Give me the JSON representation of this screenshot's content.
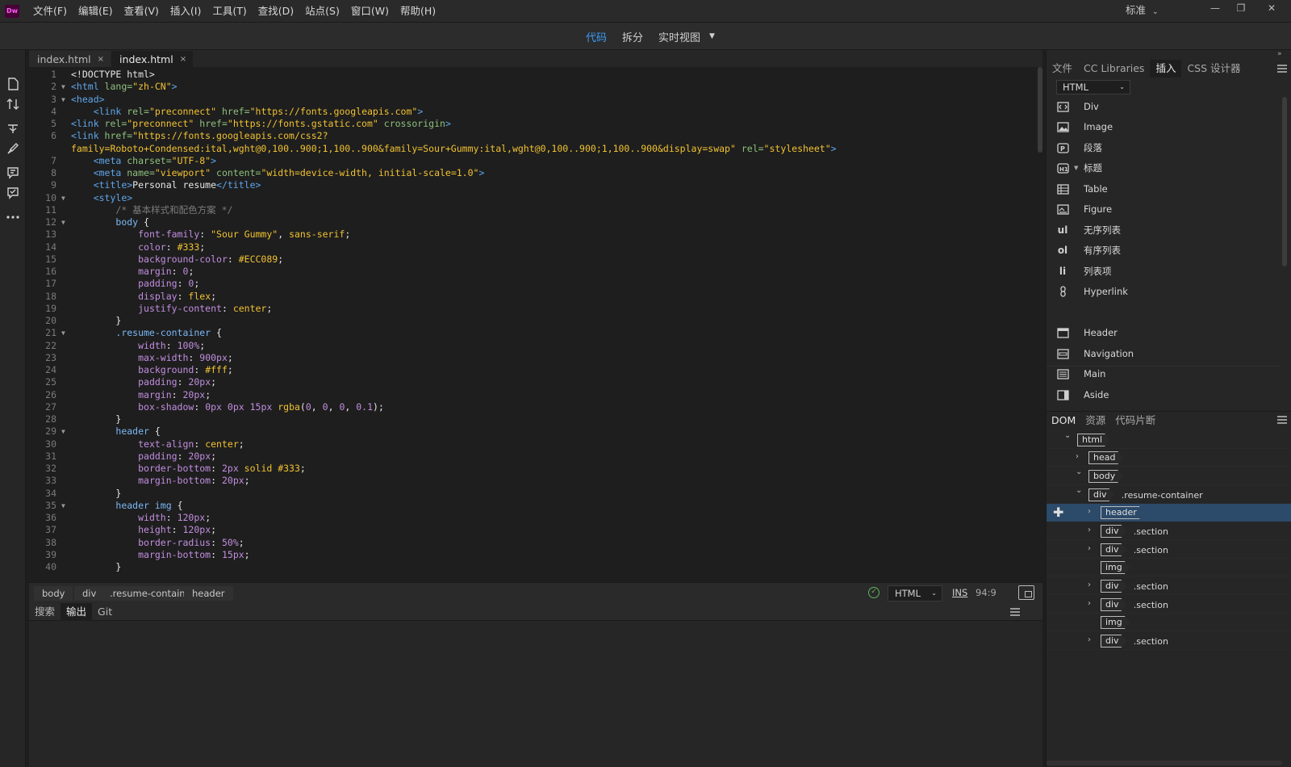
{
  "app": {
    "logo": "Dw",
    "menu": [
      "文件(F)",
      "编辑(E)",
      "查看(V)",
      "插入(I)",
      "工具(T)",
      "查找(D)",
      "站点(S)",
      "窗口(W)",
      "帮助(H)"
    ],
    "workspace": "标准",
    "window_controls": [
      "minimize",
      "restore",
      "close"
    ]
  },
  "viewbar": {
    "modes": [
      "代码",
      "拆分",
      "实时视图"
    ],
    "active": "代码"
  },
  "left_tools": [
    "file-icon",
    "transfer-icon",
    "split-arrows-icon",
    "brush-icon",
    "comment-icon",
    "checklist-icon",
    "more-icon"
  ],
  "doc_tabs": [
    {
      "label": "index.html",
      "active": false
    },
    {
      "label": "index.html",
      "active": true
    }
  ],
  "code_lines": [
    {
      "n": "1",
      "fold": "",
      "tokens": [
        [
          "t-txt",
          "<!DOCTYPE html>"
        ]
      ]
    },
    {
      "n": "2",
      "fold": "▼",
      "tokens": [
        [
          "t-tag",
          "<html "
        ],
        [
          "t-attr",
          "lang="
        ],
        [
          "t-str",
          "\"zh-CN\""
        ],
        [
          "t-tag",
          ">"
        ]
      ]
    },
    {
      "n": "3",
      "fold": "▼",
      "tokens": [
        [
          "t-tag",
          "<head>"
        ]
      ]
    },
    {
      "n": "4",
      "fold": "",
      "tokens": [
        [
          "t-txt",
          "    "
        ],
        [
          "t-tag",
          "<link "
        ],
        [
          "t-attr",
          "rel="
        ],
        [
          "t-str",
          "\"preconnect\" "
        ],
        [
          "t-attr",
          "href="
        ],
        [
          "t-str",
          "\"https://fonts.googleapis.com\""
        ],
        [
          "t-tag",
          ">"
        ]
      ]
    },
    {
      "n": "5",
      "fold": "",
      "tokens": [
        [
          "t-tag",
          "<link "
        ],
        [
          "t-attr",
          "rel="
        ],
        [
          "t-str",
          "\"preconnect\" "
        ],
        [
          "t-attr",
          "href="
        ],
        [
          "t-str",
          "\"https://fonts.gstatic.com\" "
        ],
        [
          "t-attr",
          "crossorigin"
        ],
        [
          "t-tag",
          ">"
        ]
      ]
    },
    {
      "n": "6",
      "fold": "",
      "tokens": [
        [
          "t-tag",
          "<link "
        ],
        [
          "t-attr",
          "href="
        ],
        [
          "t-str",
          "\"https://fonts.googleapis.com/css2?"
        ]
      ]
    },
    {
      "n": "",
      "fold": "",
      "tokens": [
        [
          "t-str",
          "family=Roboto+Condensed:ital,wght@0,100..900;1,100..900&family=Sour+Gummy:ital,wght@0,100..900;1,100..900&display=swap\" "
        ],
        [
          "t-attr",
          "rel="
        ],
        [
          "t-str",
          "\"stylesheet\""
        ],
        [
          "t-tag",
          ">"
        ]
      ]
    },
    {
      "n": "7",
      "fold": "",
      "tokens": [
        [
          "t-txt",
          "    "
        ],
        [
          "t-tag",
          "<meta "
        ],
        [
          "t-attr",
          "charset="
        ],
        [
          "t-str",
          "\"UTF-8\""
        ],
        [
          "t-tag",
          ">"
        ]
      ]
    },
    {
      "n": "8",
      "fold": "",
      "tokens": [
        [
          "t-txt",
          "    "
        ],
        [
          "t-tag",
          "<meta "
        ],
        [
          "t-attr",
          "name="
        ],
        [
          "t-str",
          "\"viewport\" "
        ],
        [
          "t-attr",
          "content="
        ],
        [
          "t-str",
          "\"width=device-width, initial-scale=1.0\""
        ],
        [
          "t-tag",
          ">"
        ]
      ]
    },
    {
      "n": "9",
      "fold": "",
      "tokens": [
        [
          "t-txt",
          "    "
        ],
        [
          "t-tag",
          "<title>"
        ],
        [
          "t-txt",
          "Personal resume"
        ],
        [
          "t-tag",
          "</title>"
        ]
      ]
    },
    {
      "n": "10",
      "fold": "▼",
      "tokens": [
        [
          "t-txt",
          "    "
        ],
        [
          "t-tag",
          "<style>"
        ]
      ]
    },
    {
      "n": "11",
      "fold": "",
      "tokens": [
        [
          "t-txt",
          "        "
        ],
        [
          "t-com",
          "/* 基本样式和配色方案 */"
        ]
      ]
    },
    {
      "n": "12",
      "fold": "▼",
      "tokens": [
        [
          "t-txt",
          "        "
        ],
        [
          "t-sel",
          "body "
        ],
        [
          "t-txt",
          "{"
        ]
      ]
    },
    {
      "n": "13",
      "fold": "",
      "tokens": [
        [
          "t-txt",
          "            "
        ],
        [
          "t-prop",
          "font-family"
        ],
        [
          "t-txt",
          ": "
        ],
        [
          "t-val",
          "\"Sour Gummy\""
        ],
        [
          "t-txt",
          ", "
        ],
        [
          "t-val",
          "sans-serif"
        ],
        [
          "t-txt",
          ";"
        ]
      ]
    },
    {
      "n": "14",
      "fold": "",
      "tokens": [
        [
          "t-txt",
          "            "
        ],
        [
          "t-prop",
          "color"
        ],
        [
          "t-txt",
          ": "
        ],
        [
          "t-val",
          "#333"
        ],
        [
          "t-txt",
          ";"
        ]
      ]
    },
    {
      "n": "15",
      "fold": "",
      "tokens": [
        [
          "t-txt",
          "            "
        ],
        [
          "t-prop",
          "background-color"
        ],
        [
          "t-txt",
          ": "
        ],
        [
          "t-val",
          "#ECC089"
        ],
        [
          "t-txt",
          ";"
        ]
      ]
    },
    {
      "n": "16",
      "fold": "",
      "tokens": [
        [
          "t-txt",
          "            "
        ],
        [
          "t-prop",
          "margin"
        ],
        [
          "t-txt",
          ": "
        ],
        [
          "t-num",
          "0"
        ],
        [
          "t-txt",
          ";"
        ]
      ]
    },
    {
      "n": "17",
      "fold": "",
      "tokens": [
        [
          "t-txt",
          "            "
        ],
        [
          "t-prop",
          "padding"
        ],
        [
          "t-txt",
          ": "
        ],
        [
          "t-num",
          "0"
        ],
        [
          "t-txt",
          ";"
        ]
      ]
    },
    {
      "n": "18",
      "fold": "",
      "tokens": [
        [
          "t-txt",
          "            "
        ],
        [
          "t-prop",
          "display"
        ],
        [
          "t-txt",
          ": "
        ],
        [
          "t-val",
          "flex"
        ],
        [
          "t-txt",
          ";"
        ]
      ]
    },
    {
      "n": "19",
      "fold": "",
      "tokens": [
        [
          "t-txt",
          "            "
        ],
        [
          "t-prop",
          "justify-content"
        ],
        [
          "t-txt",
          ": "
        ],
        [
          "t-val",
          "center"
        ],
        [
          "t-txt",
          ";"
        ]
      ]
    },
    {
      "n": "20",
      "fold": "",
      "tokens": [
        [
          "t-txt",
          "        }"
        ]
      ]
    },
    {
      "n": "21",
      "fold": "▼",
      "tokens": [
        [
          "t-txt",
          "        "
        ],
        [
          "t-sel",
          ".resume-container "
        ],
        [
          "t-txt",
          "{"
        ]
      ]
    },
    {
      "n": "22",
      "fold": "",
      "tokens": [
        [
          "t-txt",
          "            "
        ],
        [
          "t-prop",
          "width"
        ],
        [
          "t-txt",
          ": "
        ],
        [
          "t-num",
          "100%"
        ],
        [
          "t-txt",
          ";"
        ]
      ]
    },
    {
      "n": "23",
      "fold": "",
      "tokens": [
        [
          "t-txt",
          "            "
        ],
        [
          "t-prop",
          "max-width"
        ],
        [
          "t-txt",
          ": "
        ],
        [
          "t-num",
          "900px"
        ],
        [
          "t-txt",
          ";"
        ]
      ]
    },
    {
      "n": "24",
      "fold": "",
      "tokens": [
        [
          "t-txt",
          "            "
        ],
        [
          "t-prop",
          "background"
        ],
        [
          "t-txt",
          ": "
        ],
        [
          "t-val",
          "#fff"
        ],
        [
          "t-txt",
          ";"
        ]
      ]
    },
    {
      "n": "25",
      "fold": "",
      "tokens": [
        [
          "t-txt",
          "            "
        ],
        [
          "t-prop",
          "padding"
        ],
        [
          "t-txt",
          ": "
        ],
        [
          "t-num",
          "20px"
        ],
        [
          "t-txt",
          ";"
        ]
      ]
    },
    {
      "n": "26",
      "fold": "",
      "tokens": [
        [
          "t-txt",
          "            "
        ],
        [
          "t-prop",
          "margin"
        ],
        [
          "t-txt",
          ": "
        ],
        [
          "t-num",
          "20px"
        ],
        [
          "t-txt",
          ";"
        ]
      ]
    },
    {
      "n": "27",
      "fold": "",
      "tokens": [
        [
          "t-txt",
          "            "
        ],
        [
          "t-prop",
          "box-shadow"
        ],
        [
          "t-txt",
          ": "
        ],
        [
          "t-num",
          "0px 0px 15px "
        ],
        [
          "t-val",
          "rgba"
        ],
        [
          "t-txt",
          "("
        ],
        [
          "t-num",
          "0"
        ],
        [
          "t-txt",
          ", "
        ],
        [
          "t-num",
          "0"
        ],
        [
          "t-txt",
          ", "
        ],
        [
          "t-num",
          "0"
        ],
        [
          "t-txt",
          ", "
        ],
        [
          "t-num",
          "0.1"
        ],
        [
          "t-txt",
          ");"
        ]
      ]
    },
    {
      "n": "28",
      "fold": "",
      "tokens": [
        [
          "t-txt",
          "        }"
        ]
      ]
    },
    {
      "n": "29",
      "fold": "▼",
      "tokens": [
        [
          "t-txt",
          "        "
        ],
        [
          "t-sel",
          "header "
        ],
        [
          "t-txt",
          "{"
        ]
      ]
    },
    {
      "n": "30",
      "fold": "",
      "tokens": [
        [
          "t-txt",
          "            "
        ],
        [
          "t-prop",
          "text-align"
        ],
        [
          "t-txt",
          ": "
        ],
        [
          "t-val",
          "center"
        ],
        [
          "t-txt",
          ";"
        ]
      ]
    },
    {
      "n": "31",
      "fold": "",
      "tokens": [
        [
          "t-txt",
          "            "
        ],
        [
          "t-prop",
          "padding"
        ],
        [
          "t-txt",
          ": "
        ],
        [
          "t-num",
          "20px"
        ],
        [
          "t-txt",
          ";"
        ]
      ]
    },
    {
      "n": "32",
      "fold": "",
      "tokens": [
        [
          "t-txt",
          "            "
        ],
        [
          "t-prop",
          "border-bottom"
        ],
        [
          "t-txt",
          ": "
        ],
        [
          "t-num",
          "2px "
        ],
        [
          "t-val",
          "solid #333"
        ],
        [
          "t-txt",
          ";"
        ]
      ]
    },
    {
      "n": "33",
      "fold": "",
      "tokens": [
        [
          "t-txt",
          "            "
        ],
        [
          "t-prop",
          "margin-bottom"
        ],
        [
          "t-txt",
          ": "
        ],
        [
          "t-num",
          "20px"
        ],
        [
          "t-txt",
          ";"
        ]
      ]
    },
    {
      "n": "34",
      "fold": "",
      "tokens": [
        [
          "t-txt",
          "        }"
        ]
      ]
    },
    {
      "n": "35",
      "fold": "▼",
      "tokens": [
        [
          "t-txt",
          "        "
        ],
        [
          "t-sel",
          "header img "
        ],
        [
          "t-txt",
          "{"
        ]
      ]
    },
    {
      "n": "36",
      "fold": "",
      "tokens": [
        [
          "t-txt",
          "            "
        ],
        [
          "t-prop",
          "width"
        ],
        [
          "t-txt",
          ": "
        ],
        [
          "t-num",
          "120px"
        ],
        [
          "t-txt",
          ";"
        ]
      ]
    },
    {
      "n": "37",
      "fold": "",
      "tokens": [
        [
          "t-txt",
          "            "
        ],
        [
          "t-prop",
          "height"
        ],
        [
          "t-txt",
          ": "
        ],
        [
          "t-num",
          "120px"
        ],
        [
          "t-txt",
          ";"
        ]
      ]
    },
    {
      "n": "38",
      "fold": "",
      "tokens": [
        [
          "t-txt",
          "            "
        ],
        [
          "t-prop",
          "border-radius"
        ],
        [
          "t-txt",
          ": "
        ],
        [
          "t-num",
          "50%"
        ],
        [
          "t-txt",
          ";"
        ]
      ]
    },
    {
      "n": "39",
      "fold": "",
      "tokens": [
        [
          "t-txt",
          "            "
        ],
        [
          "t-prop",
          "margin-bottom"
        ],
        [
          "t-txt",
          ": "
        ],
        [
          "t-num",
          "15px"
        ],
        [
          "t-txt",
          ";"
        ]
      ]
    },
    {
      "n": "40",
      "fold": "",
      "tokens": [
        [
          "t-txt",
          "        }"
        ]
      ]
    }
  ],
  "status": {
    "breadcrumbs": [
      "body",
      "div",
      ".resume-container",
      "header"
    ],
    "doc_type": "HTML",
    "mode": "INS",
    "cursor": "94:9"
  },
  "output_tabs": [
    {
      "label": "搜索",
      "active": false
    },
    {
      "label": "输出",
      "active": true
    },
    {
      "label": "Git",
      "active": false
    }
  ],
  "right_panel": {
    "tabs": [
      {
        "label": "文件",
        "active": false
      },
      {
        "label": "CC Libraries",
        "active": false
      },
      {
        "label": "插入",
        "active": true
      },
      {
        "label": "CSS 设计器",
        "active": false
      }
    ],
    "insert_category": "HTML",
    "insert_items": [
      {
        "label": "Div",
        "icon": "div-icon"
      },
      {
        "label": "Image",
        "icon": "image-icon"
      },
      {
        "label": "段落",
        "icon": "paragraph-icon"
      },
      {
        "label": "标题",
        "icon": "heading-icon"
      },
      {
        "label": "Table",
        "icon": "table-icon"
      },
      {
        "label": "Figure",
        "icon": "figure-icon"
      },
      {
        "label": "无序列表",
        "icon": "unordered-list-icon"
      },
      {
        "label": "有序列表",
        "icon": "ordered-list-icon"
      },
      {
        "label": "列表项",
        "icon": "list-item-icon"
      },
      {
        "label": "Hyperlink",
        "icon": "hyperlink-icon"
      },
      {
        "label": "Header",
        "icon": "header-icon"
      },
      {
        "label": "Navigation",
        "icon": "navigation-icon"
      },
      {
        "label": "Main",
        "icon": "main-icon"
      },
      {
        "label": "Aside",
        "icon": "aside-icon"
      }
    ],
    "bottom_tabs": [
      {
        "label": "DOM",
        "active": true
      },
      {
        "label": "资源",
        "active": false
      },
      {
        "label": "代码片断",
        "active": false
      }
    ],
    "dom_tree": [
      {
        "tag": "html",
        "cls": "",
        "level": 0,
        "arrow": "⌄",
        "selected": false
      },
      {
        "tag": "head",
        "cls": "",
        "level": 1,
        "arrow": "›",
        "selected": false
      },
      {
        "tag": "body",
        "cls": "",
        "level": 1,
        "arrow": "⌄",
        "selected": false
      },
      {
        "tag": "div",
        "cls": ".resume-container",
        "level": 2,
        "arrow": "⌄",
        "selected": false
      },
      {
        "tag": "header",
        "cls": "",
        "level": 3,
        "arrow": "›",
        "selected": true
      },
      {
        "tag": "div",
        "cls": ".section",
        "level": 3,
        "arrow": "›",
        "selected": false
      },
      {
        "tag": "div",
        "cls": ".section",
        "level": 3,
        "arrow": "›",
        "selected": false
      },
      {
        "tag": "img",
        "cls": "",
        "level": 3,
        "arrow": "",
        "selected": false
      },
      {
        "tag": "div",
        "cls": ".section",
        "level": 3,
        "arrow": "›",
        "selected": false
      },
      {
        "tag": "div",
        "cls": ".section",
        "level": 3,
        "arrow": "›",
        "selected": false
      },
      {
        "tag": "img",
        "cls": "",
        "level": 3,
        "arrow": "",
        "selected": false
      },
      {
        "tag": "div",
        "cls": ".section",
        "level": 3,
        "arrow": "›",
        "selected": false
      }
    ]
  },
  "colors": {
    "accent": "#3b9cf4",
    "selection": "#2c4a6a",
    "ok": "#5fb45f"
  }
}
